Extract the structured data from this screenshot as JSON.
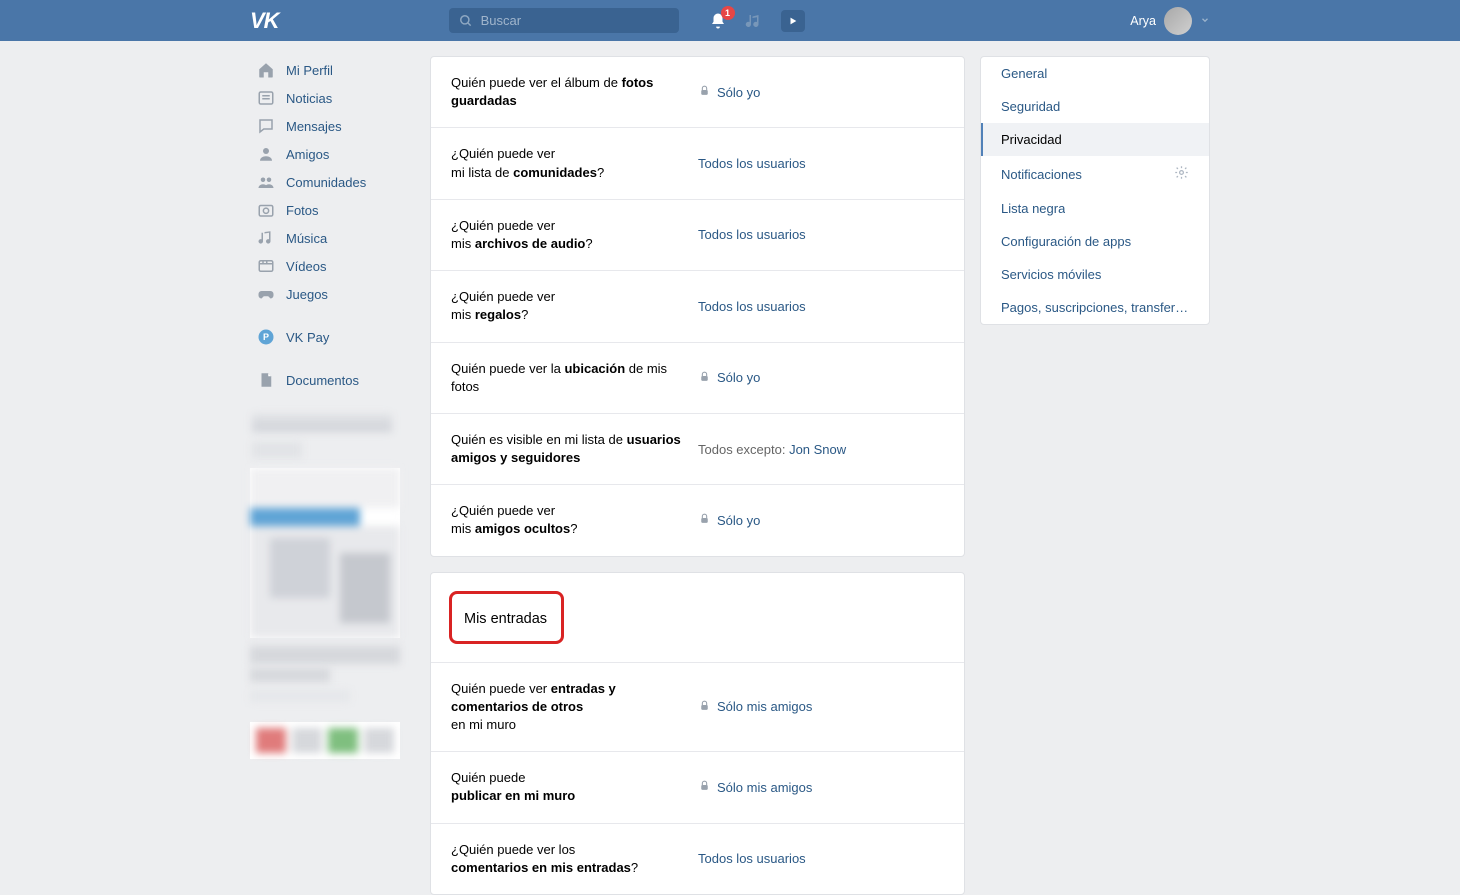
{
  "header": {
    "search_placeholder": "Buscar",
    "notification_count": "1",
    "user_name": "Arya"
  },
  "left_nav": [
    {
      "label": "Mi Perfil",
      "icon": "home"
    },
    {
      "label": "Noticias",
      "icon": "news"
    },
    {
      "label": "Mensajes",
      "icon": "message"
    },
    {
      "label": "Amigos",
      "icon": "friend"
    },
    {
      "label": "Comunidades",
      "icon": "community"
    },
    {
      "label": "Fotos",
      "icon": "photo"
    },
    {
      "label": "Música",
      "icon": "music"
    },
    {
      "label": "Vídeos",
      "icon": "video"
    },
    {
      "label": "Juegos",
      "icon": "game"
    }
  ],
  "left_nav_extra": [
    {
      "label": "VK Pay",
      "icon": "pay"
    }
  ],
  "left_nav_extra2": [
    {
      "label": "Documentos",
      "icon": "doc"
    }
  ],
  "privacy_section1": [
    {
      "label_pre": "Quién puede ver el álbum de ",
      "label_bold": "fotos guardadas",
      "label_post": "",
      "value": "Sólo yo",
      "locked": true
    },
    {
      "label_pre": "¿Quién puede ver\nmi lista de ",
      "label_bold": "comunidades",
      "label_post": "?",
      "value": "Todos los usuarios",
      "locked": false
    },
    {
      "label_pre": "¿Quién puede ver\nmis ",
      "label_bold": "archivos de audio",
      "label_post": "?",
      "value": "Todos los usuarios",
      "locked": false
    },
    {
      "label_pre": "¿Quién puede ver\nmis ",
      "label_bold": "regalos",
      "label_post": "?",
      "value": "Todos los usuarios",
      "locked": false
    },
    {
      "label_pre": "Quién puede ver la ",
      "label_bold": "ubicación",
      "label_post": " de mis fotos",
      "value": "Sólo yo",
      "locked": true
    },
    {
      "label_pre": "Quién es visible en mi lista de ",
      "label_bold": "usuarios amigos y seguidores",
      "label_post": "",
      "value_prefix": "Todos excepto: ",
      "value_user": "Jon Snow",
      "locked": false
    },
    {
      "label_pre": "¿Quién puede ver\nmis ",
      "label_bold": "amigos ocultos",
      "label_post": "?",
      "value": "Sólo yo",
      "locked": true
    }
  ],
  "section2_title": "Mis entradas",
  "privacy_section2": [
    {
      "label_pre": "Quién puede ver ",
      "label_bold": "entradas y comentarios de otros",
      "label_post": "\nen mi muro",
      "value": "Sólo mis amigos",
      "locked": true
    },
    {
      "label_pre": "Quién puede\n",
      "label_bold": "publicar en mi muro",
      "label_post": "",
      "value": "Sólo mis amigos",
      "locked": true
    },
    {
      "label_pre": "¿Quién puede ver los\n",
      "label_bold": "comentarios en mis entradas",
      "label_post": "?",
      "value": "Todos los usuarios",
      "locked": false
    }
  ],
  "right_nav": [
    {
      "label": "General",
      "active": false,
      "gear": false
    },
    {
      "label": "Seguridad",
      "active": false,
      "gear": false
    },
    {
      "label": "Privacidad",
      "active": true,
      "gear": false
    },
    {
      "label": "Notificaciones",
      "active": false,
      "gear": true
    },
    {
      "label": "Lista negra",
      "active": false,
      "gear": false
    },
    {
      "label": "Configuración de apps",
      "active": false,
      "gear": false
    },
    {
      "label": "Servicios móviles",
      "active": false,
      "gear": false
    },
    {
      "label": "Pagos, suscripciones, transferencias",
      "active": false,
      "gear": false
    }
  ]
}
